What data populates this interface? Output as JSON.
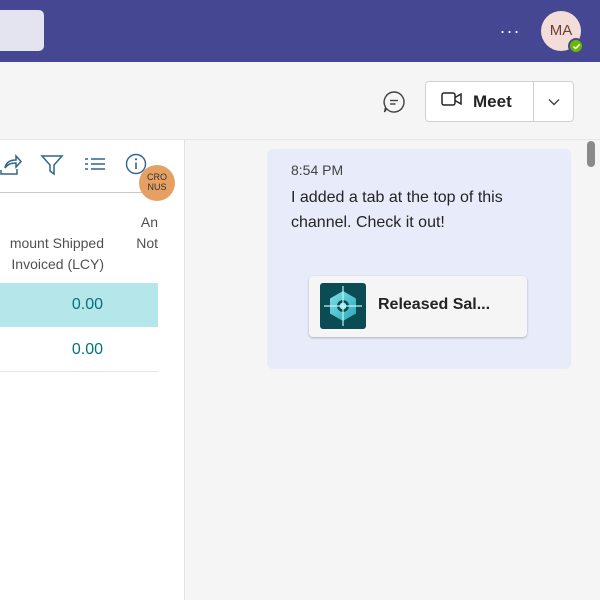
{
  "header": {
    "more_label": "···",
    "avatar_initials": "MA",
    "meet_label": "Meet"
  },
  "left_panel": {
    "badge_text": "CRO NUS",
    "column_header_lines": [
      "mount Shipped",
      "Invoiced (LCY)"
    ],
    "column_header2_lines": [
      "An",
      "Not"
    ],
    "rows": [
      {
        "value": "0.00",
        "selected": true
      },
      {
        "value": "0.00",
        "selected": false
      }
    ]
  },
  "conversation": {
    "message": {
      "time": "8:54 PM",
      "text": "I added a tab at the top of this channel. Check it out!",
      "card_label": "Released Sal..."
    }
  },
  "colors": {
    "topbar": "#464792",
    "selected_row": "#b5e6ea",
    "value_text": "#00747a",
    "bubble": "#e8ebfa",
    "card_icon_bg": "#0b4b53",
    "badge": "#e6a063",
    "presence": "#6bb700"
  }
}
